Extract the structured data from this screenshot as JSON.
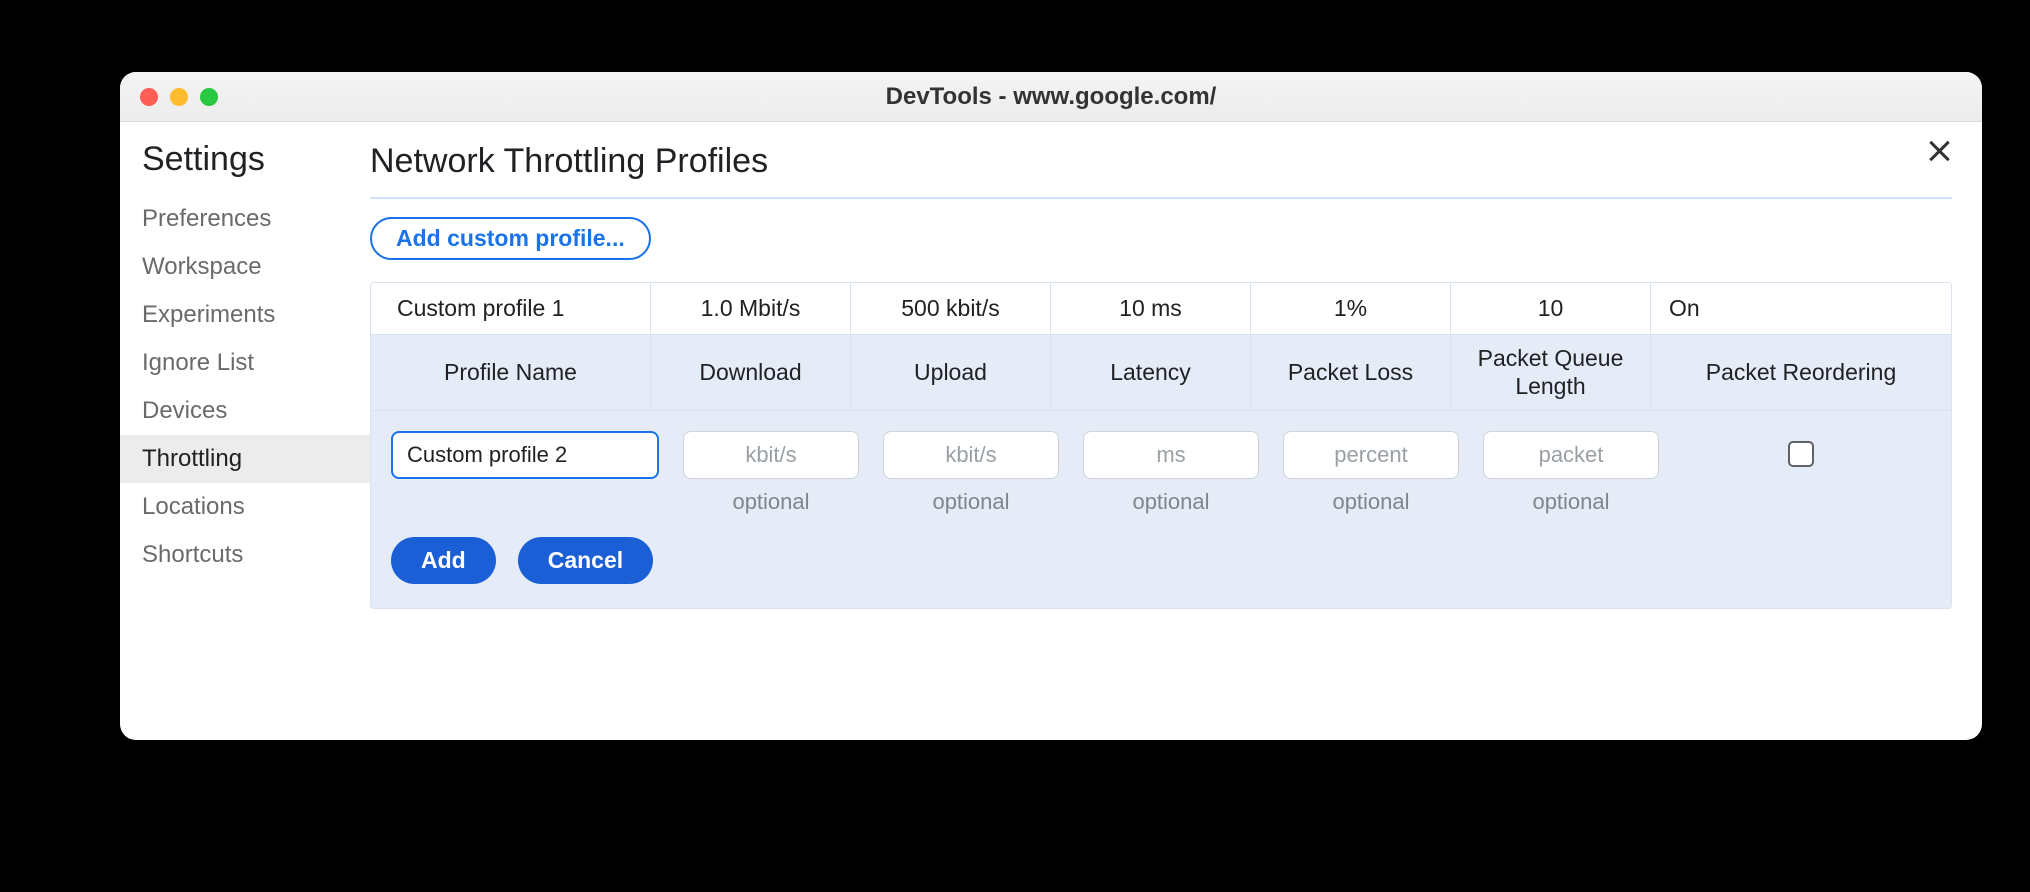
{
  "window": {
    "title": "DevTools - www.google.com/"
  },
  "sidebar": {
    "title": "Settings",
    "items": [
      {
        "label": "Preferences",
        "active": false
      },
      {
        "label": "Workspace",
        "active": false
      },
      {
        "label": "Experiments",
        "active": false
      },
      {
        "label": "Ignore List",
        "active": false
      },
      {
        "label": "Devices",
        "active": false
      },
      {
        "label": "Throttling",
        "active": true
      },
      {
        "label": "Locations",
        "active": false
      },
      {
        "label": "Shortcuts",
        "active": false
      }
    ]
  },
  "page": {
    "title": "Network Throttling Profiles",
    "add_button": "Add custom profile..."
  },
  "columns": {
    "profile_name": "Profile Name",
    "download": "Download",
    "upload": "Upload",
    "latency": "Latency",
    "packet_loss": "Packet Loss",
    "packet_queue": "Packet Queue Length",
    "packet_reorder": "Packet Reordering"
  },
  "existing_profile": {
    "name": "Custom profile 1",
    "download": "1.0 Mbit/s",
    "upload": "500 kbit/s",
    "latency": "10 ms",
    "packet_loss": "1%",
    "packet_queue": "10",
    "packet_reorder": "On"
  },
  "edit": {
    "name_value": "Custom profile 2",
    "download_placeholder": "kbit/s",
    "upload_placeholder": "kbit/s",
    "latency_placeholder": "ms",
    "loss_placeholder": "percent",
    "queue_placeholder": "packet",
    "optional_label": "optional",
    "add_label": "Add",
    "cancel_label": "Cancel"
  }
}
